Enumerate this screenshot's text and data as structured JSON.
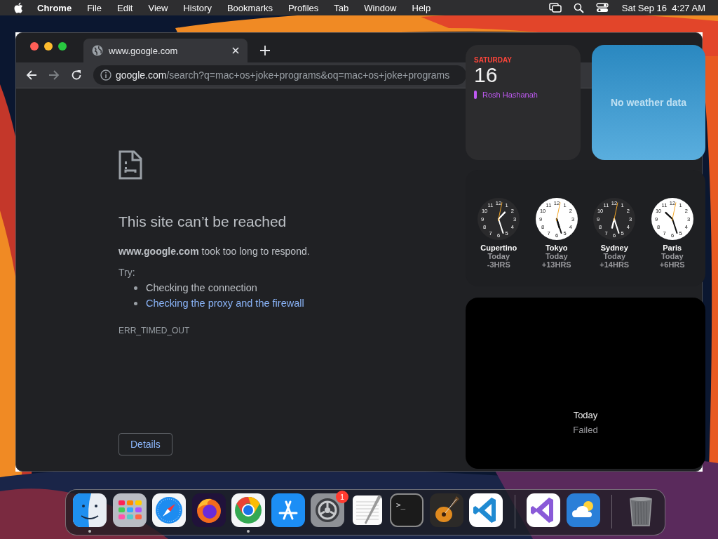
{
  "menu_bar": {
    "app": "Chrome",
    "menus": [
      "File",
      "Edit",
      "View",
      "History",
      "Bookmarks",
      "Profiles",
      "Tab",
      "Window",
      "Help"
    ],
    "clock": "Sat Sep 16  4:27 AM"
  },
  "browser": {
    "tabs": [
      {
        "title": "www.google.com",
        "selected": true
      }
    ],
    "nav": {
      "forward_disabled": true
    },
    "address": {
      "host": "google.com",
      "path": "/search?q=mac+os+joke+programs&oq=mac+os+joke+programs"
    },
    "error": {
      "title": "This site can’t be reached",
      "message": "**www.google.com** took too long to respond.",
      "try_label": "Try:",
      "suggestions": [
        {
          "text": "Checking the connection",
          "link": false
        },
        {
          "text": "Checking the proxy and the firewall",
          "link": true
        }
      ],
      "code": "ERR_TIMED_OUT",
      "details_button": "Details"
    }
  },
  "widgets": {
    "calendar": {
      "weekday": "SATURDAY",
      "day": "16",
      "events": [
        {
          "title": "Rosh Hashanah",
          "color": "#bf5af2"
        }
      ]
    },
    "weather": {
      "message": "No weather data"
    },
    "world_clock": [
      {
        "city": "Cupertino",
        "day": "Today",
        "offset": "-3HRS",
        "night": true,
        "dial": [
          "11",
          "12",
          "1",
          "10",
          "2",
          "9",
          "3",
          "8",
          "4",
          "7",
          "6",
          "5"
        ]
      },
      {
        "city": "Tokyo",
        "day": "Today",
        "offset": "+13HRS",
        "night": false,
        "dial": [
          "11",
          "12",
          "1",
          "10",
          "2",
          "9",
          "3",
          "8",
          "4",
          "7",
          "6",
          "5"
        ]
      },
      {
        "city": "Sydney",
        "day": "Today",
        "offset": "+14HRS",
        "night": true,
        "dial": [
          "11",
          "12",
          "1",
          "10",
          "2",
          "9",
          "3",
          "8",
          "4",
          "7",
          "6",
          "5"
        ]
      },
      {
        "city": "Paris",
        "day": "Today",
        "offset": "+6HRS",
        "night": false,
        "dial": [
          "11",
          "12",
          "1",
          "10",
          "2",
          "9",
          "3",
          "8",
          "4",
          "7",
          "6",
          "5"
        ]
      }
    ],
    "status": {
      "title": "Today",
      "message": "Failed"
    }
  },
  "dock": {
    "sections": [
      {
        "items": [
          {
            "kind": "finder",
            "running": true
          },
          {
            "kind": "launchpad",
            "running": false
          },
          {
            "kind": "safari",
            "running": false
          },
          {
            "kind": "firefox",
            "running": false
          },
          {
            "kind": "chrome",
            "running": true
          },
          {
            "kind": "appstore",
            "running": false
          },
          {
            "kind": "settings",
            "running": false,
            "badge": "1"
          },
          {
            "kind": "textedit",
            "running": false
          },
          {
            "kind": "terminal",
            "running": false,
            "glyph": ">_"
          },
          {
            "kind": "garageband",
            "running": false
          },
          {
            "kind": "vscode",
            "running": false
          }
        ]
      },
      {
        "items": [
          {
            "kind": "visualstudio",
            "running": false
          },
          {
            "kind": "weather",
            "running": false
          }
        ]
      },
      {
        "items": [
          {
            "kind": "trash",
            "running": false
          }
        ]
      }
    ]
  }
}
